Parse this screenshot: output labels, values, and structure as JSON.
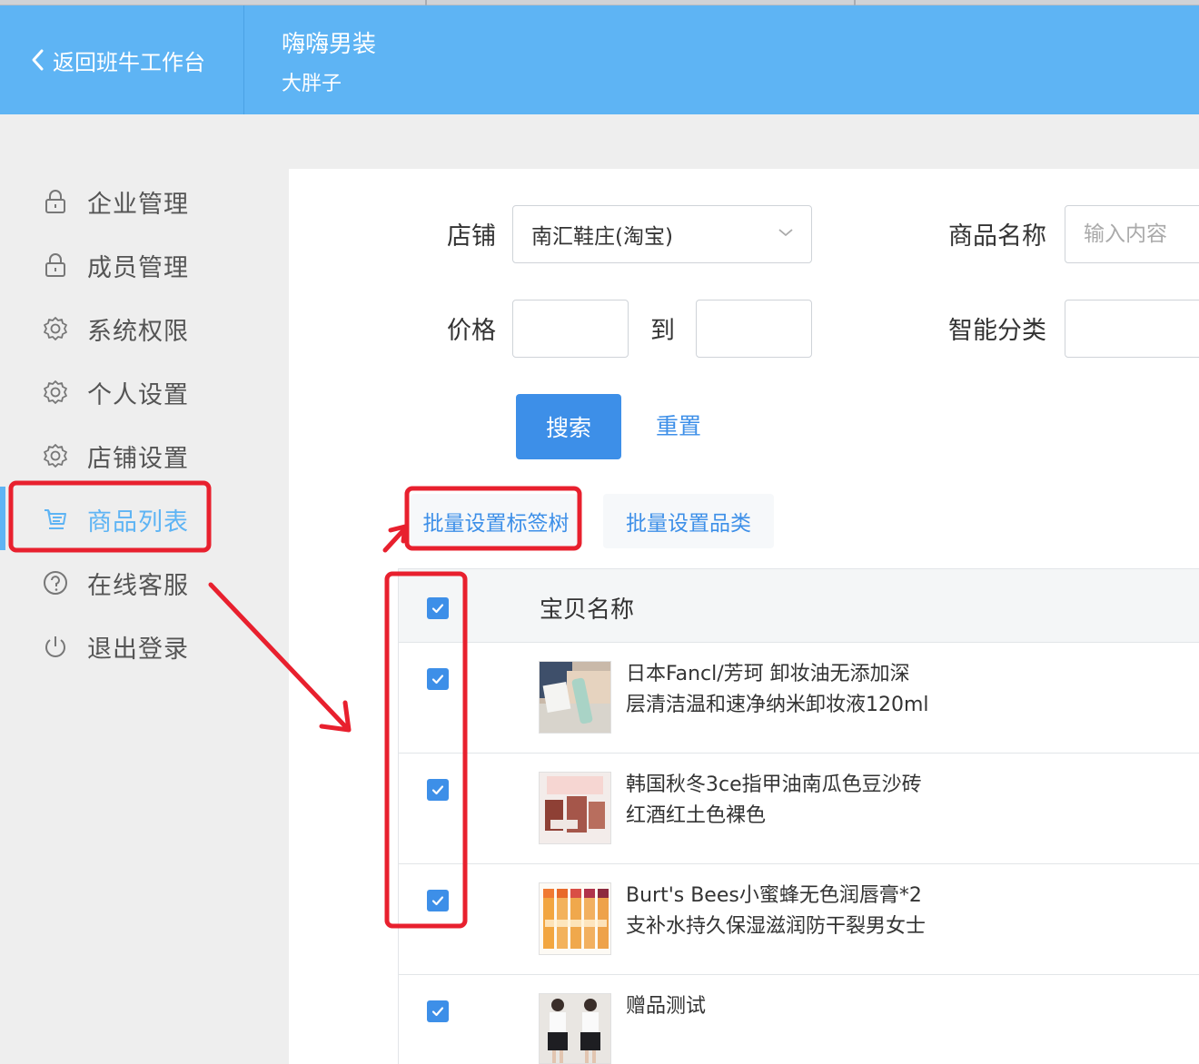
{
  "header": {
    "back_label": "返回班牛工作台",
    "shop_name": "嗨嗨男装",
    "user_name": "大胖子"
  },
  "sidebar": {
    "items": [
      {
        "label": "企业管理",
        "icon": "lock-icon"
      },
      {
        "label": "成员管理",
        "icon": "lock-icon"
      },
      {
        "label": "系统权限",
        "icon": "gear-icon"
      },
      {
        "label": "个人设置",
        "icon": "gear-icon"
      },
      {
        "label": "店铺设置",
        "icon": "gear-icon"
      },
      {
        "label": "商品列表",
        "icon": "cart-icon",
        "active": true
      },
      {
        "label": "在线客服",
        "icon": "question-icon"
      },
      {
        "label": "退出登录",
        "icon": "power-icon"
      }
    ]
  },
  "filters": {
    "shop_label": "店铺",
    "shop_value": "南汇鞋庄(淘宝)",
    "product_name_label": "商品名称",
    "product_name_placeholder": "输入内容",
    "price_label": "价格",
    "price_to": "到",
    "price_min": "",
    "price_max": "",
    "smart_category_label": "智能分类",
    "search_button": "搜索",
    "reset_button": "重置"
  },
  "batch": {
    "set_tag_tree": "批量设置标签树",
    "set_category": "批量设置品类"
  },
  "table": {
    "header_name": "宝贝名称",
    "header_checked": true,
    "rows": [
      {
        "name_line1": "日本Fancl/芳珂 卸妆油无添加深",
        "name_line2": "层清洁温和速净纳米卸妆液120ml",
        "checked": true
      },
      {
        "name_line1": "韩国秋冬3ce指甲油南瓜色豆沙砖",
        "name_line2": "红酒红土色裸色",
        "checked": true
      },
      {
        "name_line1": "Burt's Bees小蜜蜂无色润唇膏*2",
        "name_line2": "支补水持久保湿滋润防干裂男女士",
        "checked": true
      },
      {
        "name_line1": "赠品测试",
        "name_line2": "",
        "checked": true
      }
    ]
  },
  "colors": {
    "brand_blue": "#5eb4f4",
    "primary_button": "#3d8fe8",
    "annotation_red": "#e8202e"
  }
}
